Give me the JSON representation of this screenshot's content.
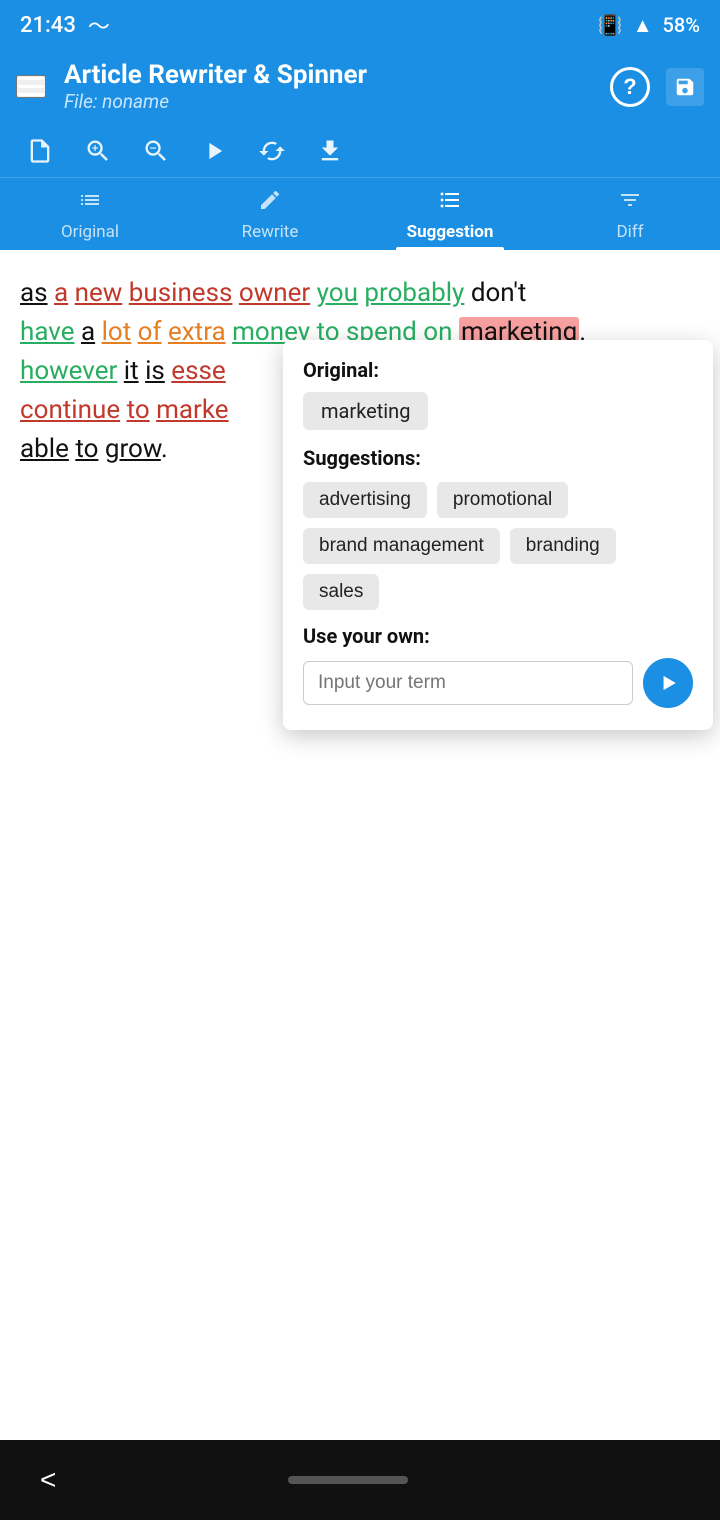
{
  "statusBar": {
    "time": "21:43",
    "battery": "58%"
  },
  "header": {
    "title": "Article Rewriter & Spinner",
    "subtitle": "File: noname",
    "helpLabel": "?",
    "menuIcon": "hamburger-icon",
    "saveIcon": "save-icon"
  },
  "toolbar": {
    "newFileLabel": "new-file",
    "zoomInLabel": "zoom-in",
    "zoomOutLabel": "zoom-out",
    "playLabel": "play",
    "repeatLabel": "repeat",
    "downloadLabel": "download"
  },
  "tabs": [
    {
      "id": "original",
      "label": "Original",
      "icon": "list-icon",
      "active": false
    },
    {
      "id": "rewrite",
      "label": "Rewrite",
      "icon": "pencil-icon",
      "active": false
    },
    {
      "id": "suggestion",
      "label": "Suggestion",
      "icon": "check-list-icon",
      "active": true
    },
    {
      "id": "diff",
      "label": "Diff",
      "icon": "diff-icon",
      "active": false
    }
  ],
  "articleText": "as a new business owner you probably don't have a lot of extra money to spend on marketing. however it is esse continue to marke able to grow.",
  "popup": {
    "originalLabel": "Original:",
    "originalWord": "marketing",
    "suggestionsLabel": "Suggestions:",
    "suggestions": [
      "advertising",
      "promotional",
      "brand management",
      "branding",
      "sales"
    ],
    "useOwnLabel": "Use your own:",
    "inputPlaceholder": "Input your term"
  },
  "bottomNav": {
    "backLabel": "<"
  }
}
